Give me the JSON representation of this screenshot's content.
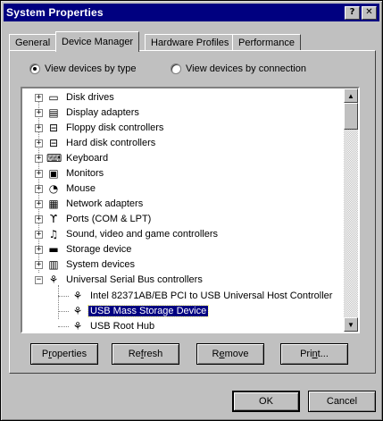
{
  "window": {
    "title": "System Properties"
  },
  "titlebar_buttons": {
    "help": "?",
    "close": "✕"
  },
  "tabs": [
    {
      "label": "General"
    },
    {
      "label": "Device Manager"
    },
    {
      "label": "Hardware Profiles"
    },
    {
      "label": "Performance"
    }
  ],
  "radios": {
    "by_type": {
      "label": "View devices by type",
      "selected": true
    },
    "by_connection": {
      "label": "View devices by connection",
      "selected": false
    }
  },
  "devices": [
    {
      "label": "Disk drives",
      "icon": "disk-drive-icon",
      "expander": "+"
    },
    {
      "label": "Display adapters",
      "icon": "display-adapter-icon",
      "expander": "+"
    },
    {
      "label": "Floppy disk controllers",
      "icon": "floppy-controller-icon",
      "expander": "+"
    },
    {
      "label": "Hard disk controllers",
      "icon": "hard-disk-controller-icon",
      "expander": "+"
    },
    {
      "label": "Keyboard",
      "icon": "keyboard-icon",
      "expander": "+"
    },
    {
      "label": "Monitors",
      "icon": "monitor-icon",
      "expander": "+"
    },
    {
      "label": "Mouse",
      "icon": "mouse-icon",
      "expander": "+"
    },
    {
      "label": "Network adapters",
      "icon": "network-adapter-icon",
      "expander": "+"
    },
    {
      "label": "Ports (COM & LPT)",
      "icon": "port-icon",
      "expander": "+"
    },
    {
      "label": "Sound, video and game controllers",
      "icon": "sound-icon",
      "expander": "+"
    },
    {
      "label": "Storage device",
      "icon": "storage-device-icon",
      "expander": "+"
    },
    {
      "label": "System devices",
      "icon": "system-devices-icon",
      "expander": "+"
    },
    {
      "label": "Universal Serial Bus controllers",
      "icon": "usb-icon",
      "expander": "−"
    }
  ],
  "usb_children": [
    {
      "label": "Intel 82371AB/EB PCI to USB Universal Host Controller",
      "icon": "usb-icon",
      "selected": false
    },
    {
      "label": "USB Mass Storage Device",
      "icon": "usb-icon",
      "selected": true
    },
    {
      "label": "USB Root Hub",
      "icon": "usb-icon",
      "selected": false
    }
  ],
  "scrollbar": {
    "up": "▲",
    "down": "▼"
  },
  "action_buttons": {
    "properties": {
      "pre": "P",
      "u": "r",
      "post": "operties"
    },
    "refresh": {
      "pre": "Re",
      "u": "f",
      "post": "resh"
    },
    "remove": {
      "pre": "R",
      "u": "e",
      "post": "move"
    },
    "print": {
      "pre": "Pri",
      "u": "n",
      "post": "t..."
    }
  },
  "dialog_buttons": {
    "ok": "OK",
    "cancel": "Cancel"
  }
}
